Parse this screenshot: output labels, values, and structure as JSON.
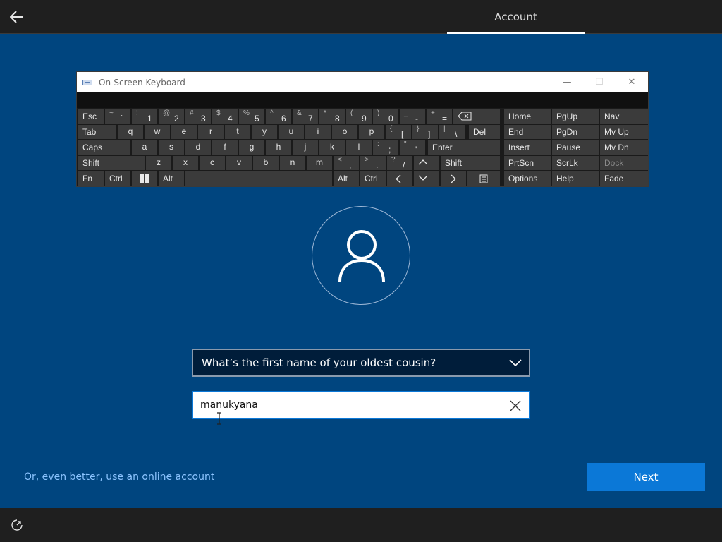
{
  "header": {
    "tab_label": "Account",
    "back_icon": "arrow-left-icon"
  },
  "osk": {
    "title": "On-Screen Keyboard",
    "controls": {
      "minimize": "—",
      "maximize": "☐",
      "close": "✕"
    },
    "keys": {
      "esc": "Esc",
      "tab": "Tab",
      "caps": "Caps",
      "shift_left": "Shift",
      "fn": "Fn",
      "ctrl_left": "Ctrl",
      "alt_left": "Alt",
      "alt_right": "Alt",
      "ctrl_right": "Ctrl",
      "del": "Del",
      "enter": "Enter",
      "shift_right": "Shift",
      "home": "Home",
      "pgup": "PgUp",
      "nav": "Nav",
      "end": "End",
      "pgdn": "PgDn",
      "mvup": "Mv Up",
      "insert": "Insert",
      "pause": "Pause",
      "mvdn": "Mv Dn",
      "prtscn": "PrtScn",
      "scrlk": "ScrLk",
      "dock": "Dock",
      "options": "Options",
      "help": "Help",
      "fade": "Fade",
      "row1": [
        {
          "top": "~",
          "bot": "`"
        },
        {
          "top": "!",
          "bot": "1"
        },
        {
          "top": "@",
          "bot": "2"
        },
        {
          "top": "#",
          "bot": "3"
        },
        {
          "top": "$",
          "bot": "4"
        },
        {
          "top": "%",
          "bot": "5"
        },
        {
          "top": "^",
          "bot": "6"
        },
        {
          "top": "&",
          "bot": "7"
        },
        {
          "top": "*",
          "bot": "8"
        },
        {
          "top": "(",
          "bot": "9"
        },
        {
          "top": ")",
          "bot": "0"
        },
        {
          "top": "_",
          "bot": "-"
        },
        {
          "top": "+",
          "bot": "="
        }
      ],
      "row2": [
        "q",
        "w",
        "e",
        "r",
        "t",
        "y",
        "u",
        "i",
        "o",
        "p"
      ],
      "row2_brackets": [
        {
          "top": "{",
          "bot": "["
        },
        {
          "top": "}",
          "bot": "]"
        },
        {
          "top": "|",
          "bot": "\\"
        }
      ],
      "row3": [
        "a",
        "s",
        "d",
        "f",
        "g",
        "h",
        "j",
        "k",
        "l"
      ],
      "row3_punct": [
        {
          "top": ":",
          "bot": ";"
        },
        {
          "top": "\"",
          "bot": "'"
        }
      ],
      "row4": [
        "z",
        "x",
        "c",
        "v",
        "b",
        "n",
        "m"
      ],
      "row4_punct": [
        {
          "top": "<",
          "bot": ","
        },
        {
          "top": ">",
          "bot": "."
        },
        {
          "top": "?",
          "bot": "/"
        }
      ]
    }
  },
  "avatar": {
    "icon": "user-icon"
  },
  "question": {
    "selected": "What’s the first name of your oldest cousin?"
  },
  "answer": {
    "value": "manukyana"
  },
  "footer": {
    "online_link": "Or, even better, use an online account",
    "next_label": "Next",
    "ease_icon": "ease-of-access-icon"
  },
  "colors": {
    "background": "#00457f",
    "accent": "#0b78d7",
    "bar": "#1f1f1f",
    "link": "#8cc4ff"
  }
}
